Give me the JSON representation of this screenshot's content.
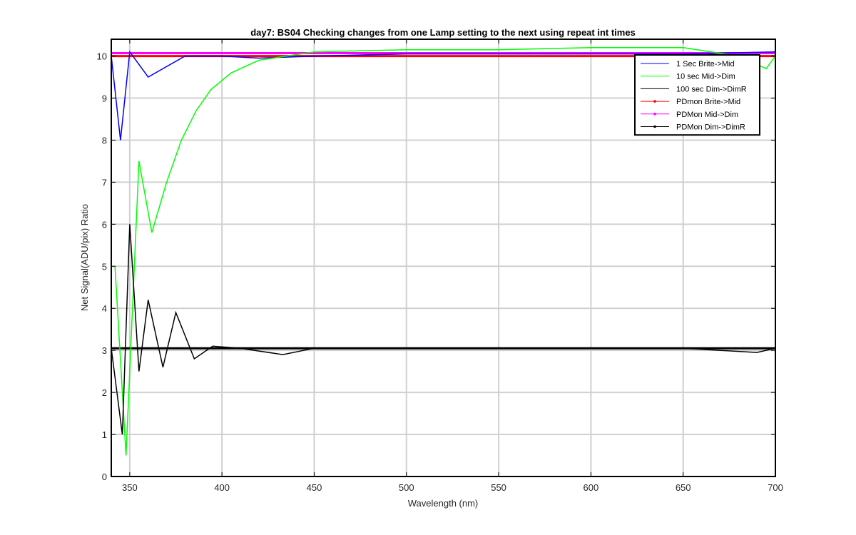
{
  "chart_data": {
    "type": "line",
    "title": "day7: BS04  Checking changes from one Lamp setting to the next using repeat int times",
    "xlabel": "Wavelength (nm)",
    "ylabel": "Net Signal(ADU/pix) Ratio",
    "xlim": [
      340,
      700
    ],
    "ylim": [
      0,
      10.4
    ],
    "x_ticks": [
      "350",
      "400",
      "450",
      "500",
      "550",
      "600",
      "650",
      "700"
    ],
    "y_ticks": [
      "0",
      "1",
      "2",
      "3",
      "4",
      "5",
      "6",
      "7",
      "8",
      "9",
      "10"
    ],
    "grid": true,
    "legend_position": "top-right",
    "series": [
      {
        "name": "1 Sec Brite->Mid",
        "color": "#0000ff",
        "marker": "none",
        "x": [
          340,
          345,
          350,
          360,
          380,
          400,
          420,
          450,
          500,
          600,
          650,
          700
        ],
        "y": [
          10.0,
          8.0,
          10.1,
          9.5,
          10.0,
          10.0,
          9.95,
          10.0,
          10.05,
          10.05,
          10.05,
          10.1
        ]
      },
      {
        "name": "10 sec Mid->Dim",
        "color": "#00ff00",
        "marker": "none",
        "x": [
          342,
          348,
          355,
          362,
          370,
          378,
          386,
          394,
          405,
          420,
          450,
          500,
          550,
          600,
          650,
          680,
          695,
          700
        ],
        "y": [
          5.0,
          0.5,
          7.5,
          5.8,
          7.0,
          8.0,
          8.7,
          9.2,
          9.6,
          9.9,
          10.1,
          10.15,
          10.15,
          10.2,
          10.2,
          10.0,
          9.7,
          10.0
        ]
      },
      {
        "name": "100 sec Dim->DimR",
        "color": "#000000",
        "marker": "none",
        "x": [
          340,
          346,
          350,
          355,
          360,
          368,
          375,
          385,
          395,
          410,
          433,
          450,
          500,
          550,
          600,
          650,
          690,
          700
        ],
        "y": [
          3.05,
          1.0,
          6.0,
          2.5,
          4.2,
          2.6,
          3.9,
          2.8,
          3.1,
          3.05,
          2.9,
          3.05,
          3.05,
          3.05,
          3.05,
          3.05,
          2.95,
          3.05
        ]
      },
      {
        "name": "PDmon Brite->Mid",
        "color": "#ff0000",
        "marker": "dot",
        "x": [
          340,
          700
        ],
        "y": [
          10.0,
          10.0
        ]
      },
      {
        "name": "PDMon Mid->Dim",
        "color": "#ff00ff",
        "marker": "dot",
        "x": [
          340,
          700
        ],
        "y": [
          10.07,
          10.07
        ]
      },
      {
        "name": "PDMon Dim->DimR",
        "color": "#000000",
        "marker": "dot",
        "x": [
          340,
          700
        ],
        "y": [
          3.05,
          3.05
        ]
      }
    ]
  }
}
